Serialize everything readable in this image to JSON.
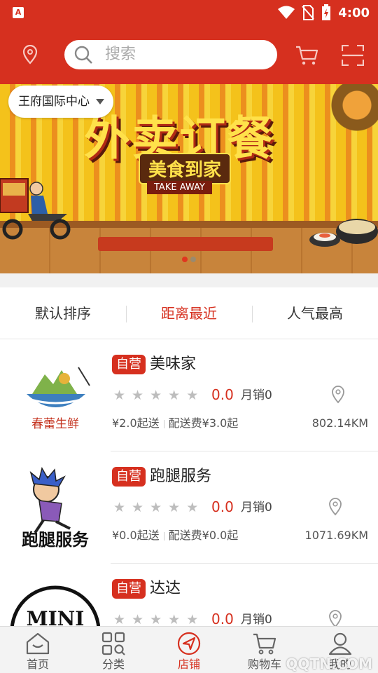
{
  "status_bar": {
    "time": "4:00",
    "app_badge": "A"
  },
  "header": {
    "search_placeholder": "搜索",
    "location_icon": "location-pin-icon",
    "cart_icon": "cart-icon",
    "scan_icon": "scan-icon"
  },
  "banner": {
    "location_chip": "王府国际中心",
    "title": "外卖订餐",
    "subtitle": "美食到家",
    "english": "TAKE AWAY",
    "dot_count": 2,
    "active_dot": 0
  },
  "sort_tabs": [
    {
      "label": "默认排序",
      "active": false
    },
    {
      "label": "距离最近",
      "active": true
    },
    {
      "label": "人气最高",
      "active": false
    }
  ],
  "stores": [
    {
      "badge": "自营",
      "name": "美味家",
      "rating": "0.0",
      "sales": "月销0",
      "min_order": "¥2.0起送",
      "delivery_fee": "配送费¥3.0起",
      "distance": "802.14KM",
      "logo_text": "春蕾生鲜"
    },
    {
      "badge": "自营",
      "name": "跑腿服务",
      "rating": "0.0",
      "sales": "月销0",
      "min_order": "¥0.0起送",
      "delivery_fee": "配送费¥0.0起",
      "distance": "1071.69KM",
      "logo_text": "跑腿服务"
    },
    {
      "badge": "自营",
      "name": "达达",
      "rating": "0.0",
      "sales": "月销0",
      "min_order": "",
      "delivery_fee": "",
      "distance": "",
      "logo_text": "MINI"
    }
  ],
  "bottom_nav": [
    {
      "label": "首页",
      "icon": "home-icon",
      "active": false
    },
    {
      "label": "分类",
      "icon": "category-icon",
      "active": false
    },
    {
      "label": "店铺",
      "icon": "store-navigate-icon",
      "active": true
    },
    {
      "label": "购物车",
      "icon": "cart-icon",
      "active": false
    },
    {
      "label": "我的",
      "icon": "profile-icon",
      "active": false
    }
  ],
  "watermark": "QQTN.COM",
  "colors": {
    "brand_red": "#d6301f",
    "text_dark": "#222222",
    "star_gray": "#bdbdbd"
  }
}
